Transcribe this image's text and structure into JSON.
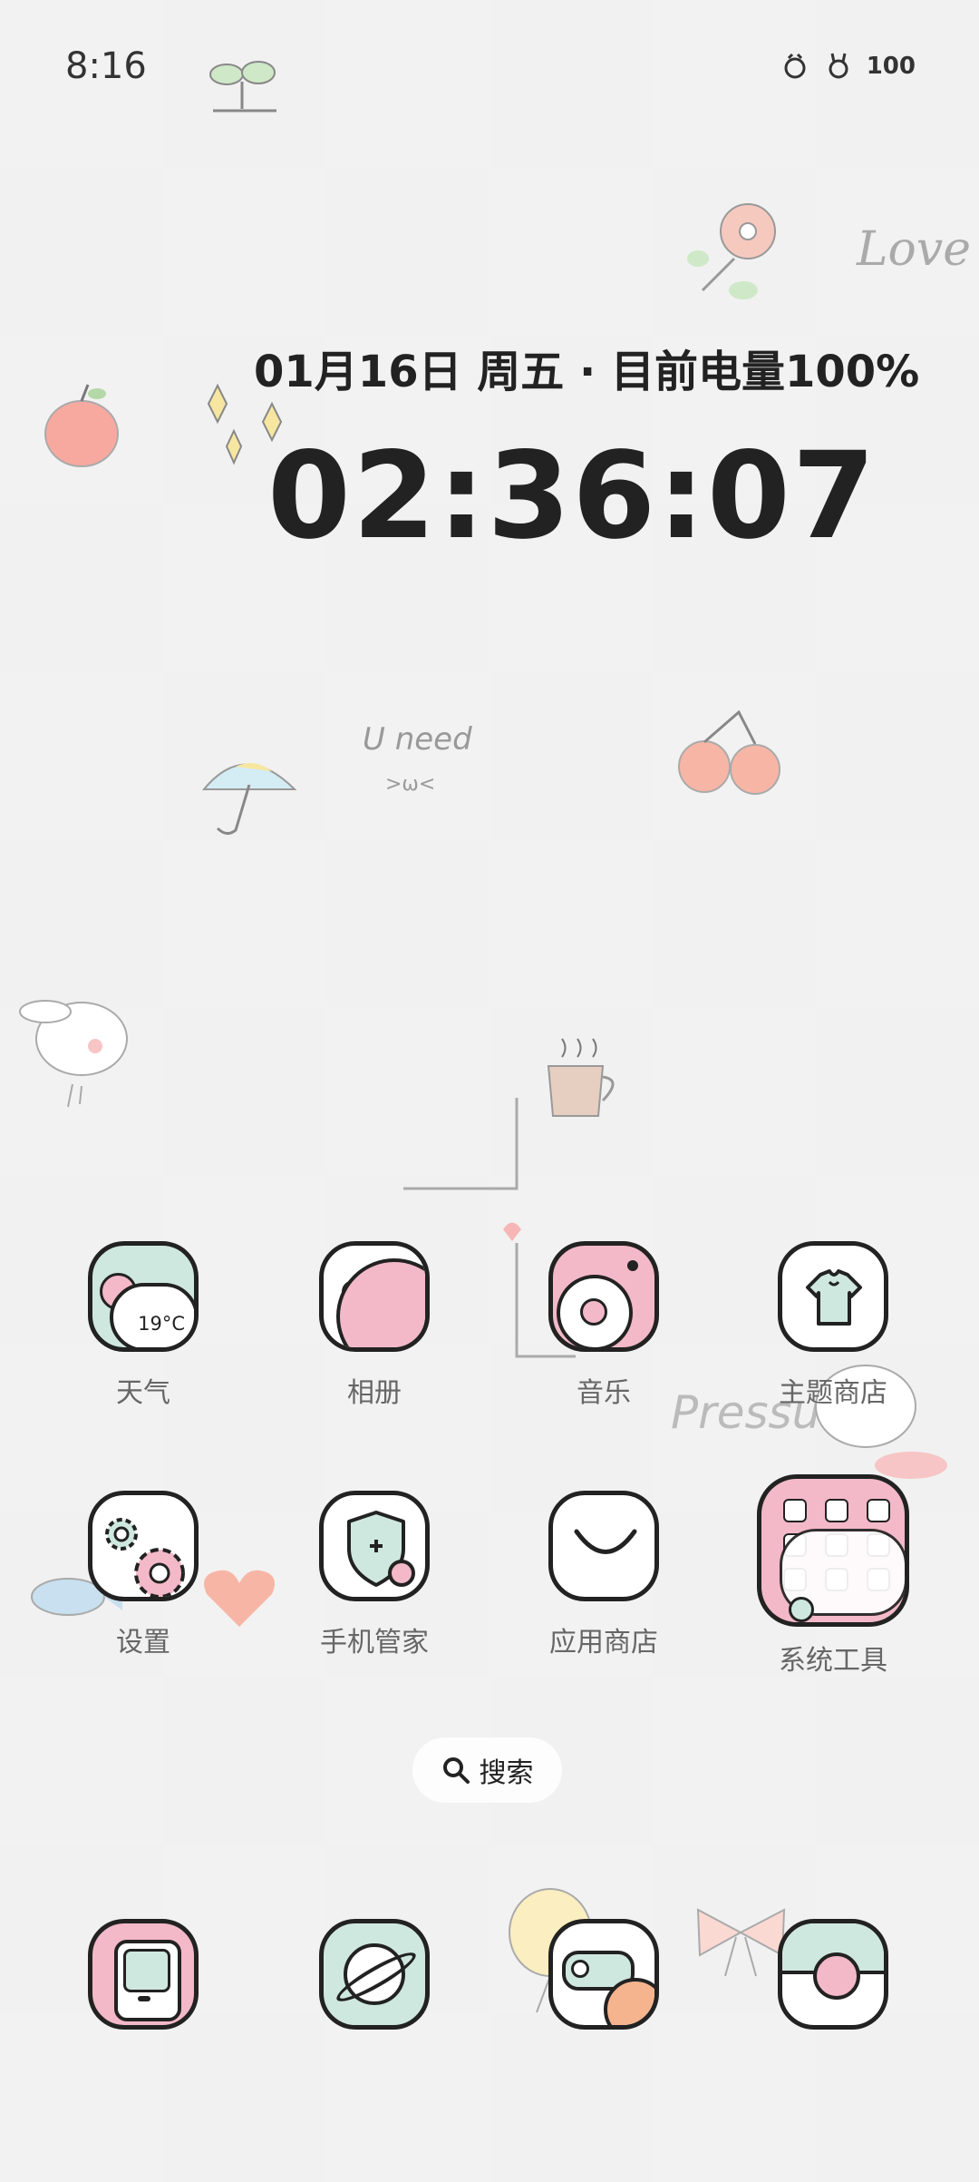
{
  "status_bar": {
    "time": "8:16",
    "battery": "100"
  },
  "widget": {
    "date_line": "01月16日 周五 · 目前电量100%",
    "clock": "02:36:07"
  },
  "decor_text": {
    "love": "Love",
    "u_need": "U need",
    "face": ">ω<",
    "pressure": "Pressure"
  },
  "apps_row1": [
    {
      "label": "天气",
      "icon": "weather-icon",
      "temp": "19°C"
    },
    {
      "label": "相册",
      "icon": "gallery-icon"
    },
    {
      "label": "音乐",
      "icon": "music-icon"
    },
    {
      "label": "主题商店",
      "icon": "theme-store-icon"
    }
  ],
  "apps_row2": [
    {
      "label": "设置",
      "icon": "settings-icon"
    },
    {
      "label": "手机管家",
      "icon": "phone-manager-icon"
    },
    {
      "label": "应用商店",
      "icon": "app-store-icon"
    },
    {
      "label": "系统工具",
      "icon": "system-tools-folder-icon"
    }
  ],
  "search": {
    "label": "搜索"
  },
  "dock": [
    {
      "icon": "phone-icon"
    },
    {
      "icon": "browser-icon"
    },
    {
      "icon": "messages-icon"
    },
    {
      "icon": "camera-icon"
    }
  ],
  "colors": {
    "mint": "#cfe8df",
    "pink": "#f3b9c8",
    "outline": "#222222"
  }
}
